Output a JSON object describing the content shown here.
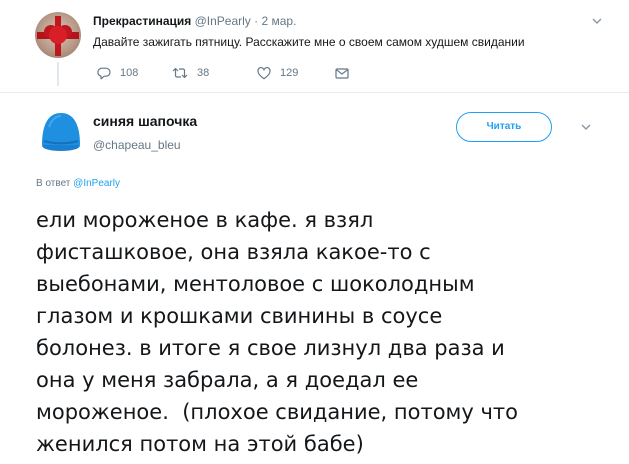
{
  "parent_tweet": {
    "author_name": "Прекрастинация",
    "author_handle": "@InPearly",
    "separator": "·",
    "time": "2 мар.",
    "text": "Давайте зажигать пятницу. Расскажите мне о своем самом худшем свидании",
    "actions": {
      "replies": "108",
      "retweets": "38",
      "likes": "129"
    },
    "icons": {
      "reply": "reply-icon",
      "retweet": "retweet-icon",
      "like": "heart-icon",
      "dm": "envelope-icon",
      "more": "chevron-down-icon"
    }
  },
  "main_tweet": {
    "author_name": "синяя шапочка",
    "author_handle": "@chapeau_bleu",
    "follow_label": "Читать",
    "reply_to": {
      "prefix": "В ответ",
      "mention": "@InPearly"
    },
    "text_lines": [
      "ели мороженое в кафе. я взял",
      "фисташковое, она взяла какое-то с",
      "выебонами, ментоловое с шоколодным",
      "глазом и крошками свинины в соусе",
      "болонез. в итоге я свое лизнул два раза и",
      "она у меня забрала, а я доедал ее",
      "мороженое.  (плохое свидание, потому что",
      "женился потом на этой бабе)"
    ],
    "icons": {
      "more": "chevron-down-icon"
    }
  },
  "colors": {
    "accent": "#1da1f2",
    "secondary_text": "#657786",
    "primary_text": "#14171a",
    "avatar_blue": "#1f8fe0"
  }
}
